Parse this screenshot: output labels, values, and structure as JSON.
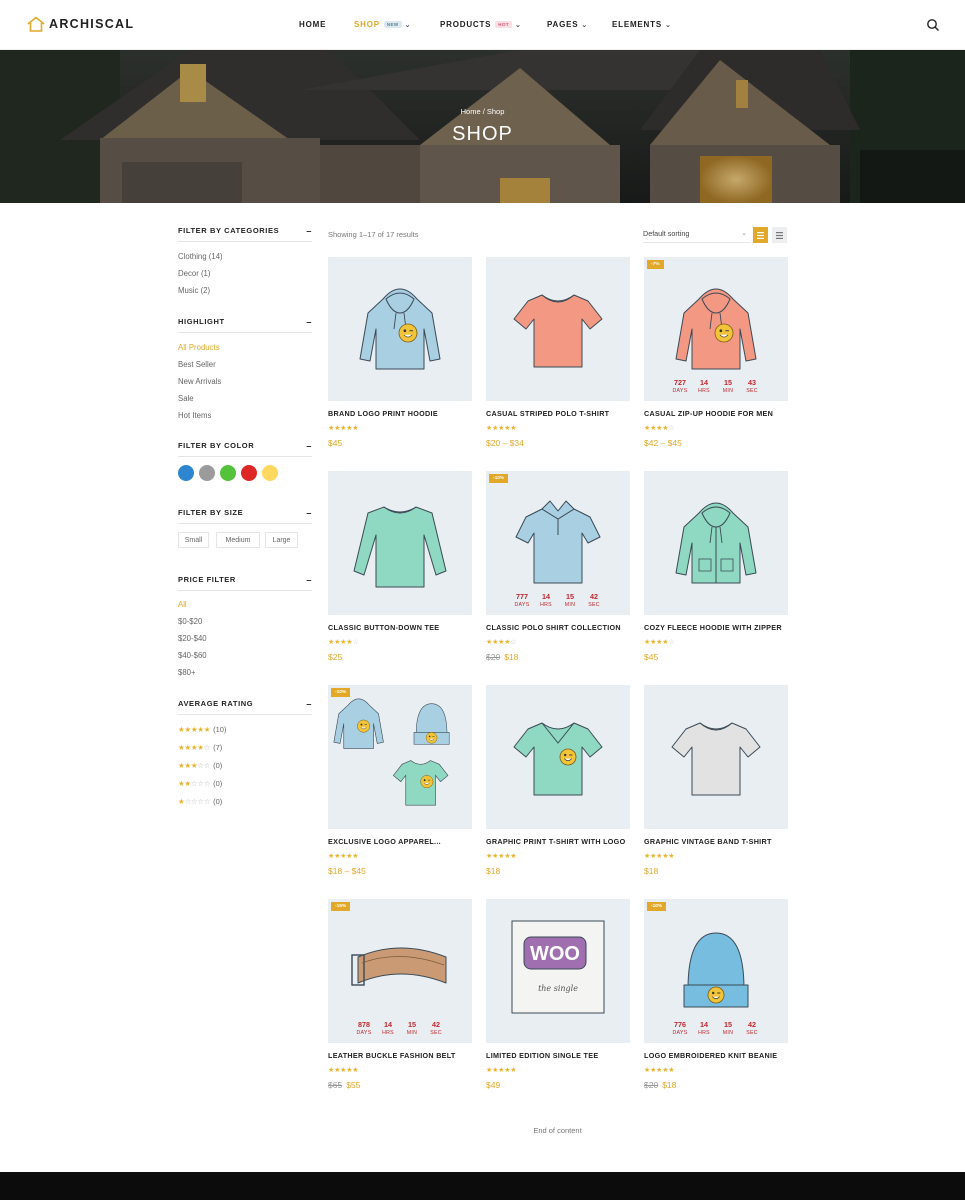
{
  "header": {
    "logo_text": "ARCHISCAL",
    "nav": [
      {
        "label": "HOME"
      },
      {
        "label": "SHOP",
        "badge": "NEW",
        "has_chevron": true,
        "active": true
      },
      {
        "label": "PRODUCTS",
        "badge": "HOT",
        "has_chevron": true
      },
      {
        "label": "PAGES",
        "has_chevron": true
      },
      {
        "label": "ELEMENTS",
        "has_chevron": true
      }
    ],
    "search_icon": "search-icon"
  },
  "hero": {
    "breadcrumb": "Home / Shop",
    "title": "SHOP"
  },
  "sidebar": {
    "categories": {
      "title": "FILTER BY CATEGORIES",
      "items": [
        "Clothing (14)",
        "Decor (1)",
        "Music (2)"
      ]
    },
    "highlight": {
      "title": "HIGHLIGHT",
      "items": [
        "All Products",
        "Best Seller",
        "New Arrivals",
        "Sale",
        "Hot Items"
      ],
      "active_index": 0
    },
    "color": {
      "title": "FILTER BY COLOR",
      "swatches": [
        "#2f86d0",
        "#9b9b9b",
        "#54c23a",
        "#dd2727",
        "#ffd860"
      ]
    },
    "size": {
      "title": "FILTER BY SIZE",
      "items": [
        "Small",
        "Medium",
        "Large"
      ]
    },
    "price": {
      "title": "PRICE FILTER",
      "items": [
        "All",
        "$0-$20",
        "$20-$40",
        "$40-$60",
        "$80+"
      ],
      "active_index": 0
    },
    "rating": {
      "title": "AVERAGE RATING",
      "items": [
        {
          "stars": 5,
          "count": "(10)"
        },
        {
          "stars": 4,
          "count": "(7)"
        },
        {
          "stars": 3,
          "count": "(0)"
        },
        {
          "stars": 2,
          "count": "(0)"
        },
        {
          "stars": 1,
          "count": "(0)"
        }
      ]
    }
  },
  "toolbar": {
    "result_count": "Showing 1–17 of 17 results",
    "sort_label": "Default sorting"
  },
  "products": [
    {
      "name": "BRAND LOGO PRINT HOODIE",
      "rating": 5,
      "price": "$45",
      "art": "hoodie",
      "color": "#a9cfe3"
    },
    {
      "name": "CASUAL STRIPED POLO T-SHIRT",
      "rating": 4.5,
      "price": "$20 – $34",
      "art": "tshirt",
      "color": "#f39883"
    },
    {
      "name": "CASUAL ZIP-UP HOODIE FOR MEN",
      "rating": 4,
      "price": "$42 – $45",
      "art": "hoodie",
      "color": "#f39883",
      "badge": "-7%",
      "timer": [
        "727",
        "14",
        "15",
        "43"
      ]
    },
    {
      "name": "CLASSIC BUTTON-DOWN TEE",
      "rating": 4,
      "price": "$25",
      "art": "longsleeve",
      "color": "#8fd8c1"
    },
    {
      "name": "CLASSIC POLO SHIRT COLLECTION",
      "rating": 4,
      "old_price": "$20",
      "price": "$18",
      "art": "polo",
      "color": "#a9cfe3",
      "badge": "-10%",
      "timer": [
        "777",
        "14",
        "15",
        "42"
      ]
    },
    {
      "name": "COZY FLEECE HOODIE WITH ZIPPER",
      "rating": 4,
      "price": "$45",
      "art": "zip",
      "color": "#8fd8c1"
    },
    {
      "name": "EXCLUSIVE LOGO APPAREL...",
      "rating": 5,
      "price": "$18 – $45",
      "art": "bundle",
      "color": "#a9cfe3",
      "badge": "-10%"
    },
    {
      "name": "GRAPHIC PRINT T-SHIRT WITH LOGO",
      "rating": 4.5,
      "price": "$18",
      "art": "vneck",
      "color": "#8fd8c1"
    },
    {
      "name": "GRAPHIC VINTAGE BAND T-SHIRT",
      "rating": 5,
      "price": "$18",
      "art": "tshirt",
      "color": "#e2e2e2"
    },
    {
      "name": "LEATHER BUCKLE FASHION BELT",
      "rating": 5,
      "old_price": "$65",
      "price": "$55",
      "art": "belt",
      "color": "#c99a73",
      "badge": "-15%",
      "timer": [
        "878",
        "14",
        "15",
        "42"
      ]
    },
    {
      "name": "LIMITED EDITION SINGLE TEE",
      "rating": 5,
      "price": "$49",
      "art": "album",
      "color": "#9f6fb0"
    },
    {
      "name": "LOGO EMBROIDERED KNIT BEANIE",
      "rating": 5,
      "old_price": "$20",
      "price": "$18",
      "art": "beanie",
      "color": "#76bde0",
      "badge": "-10%",
      "timer": [
        "776",
        "14",
        "15",
        "42"
      ]
    }
  ],
  "timer_labels": [
    "DAYS",
    "HRS",
    "MIN",
    "SEC"
  ],
  "art_labels": {
    "woo": "WOO",
    "single": "the single"
  },
  "end_text": "End of content"
}
